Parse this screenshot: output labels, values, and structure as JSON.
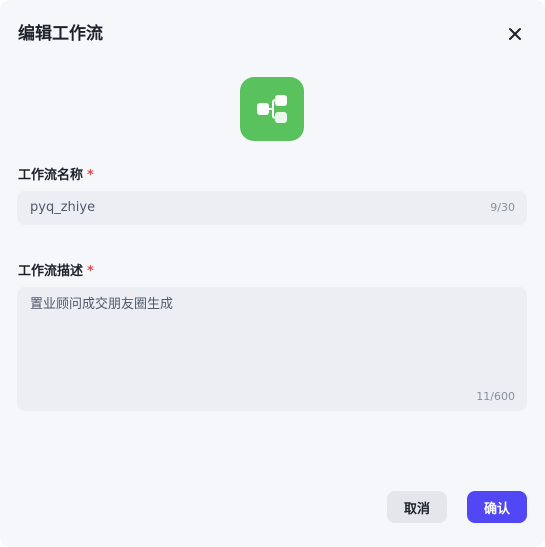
{
  "dialog": {
    "title": "编辑工作流",
    "close_icon": "close-icon"
  },
  "app_icon": {
    "icon": "workflow-nodes-icon",
    "bg_color": "#5ac25c"
  },
  "name_field": {
    "label": "工作流名称",
    "required_mark": "*",
    "value": "pyq_zhiye",
    "counter": "9/30"
  },
  "desc_field": {
    "label": "工作流描述",
    "required_mark": "*",
    "value": "置业顾问成交朋友圈生成",
    "counter": "11/600"
  },
  "footer": {
    "cancel_label": "取消",
    "confirm_label": "确认",
    "confirm_color": "#5147f5"
  }
}
